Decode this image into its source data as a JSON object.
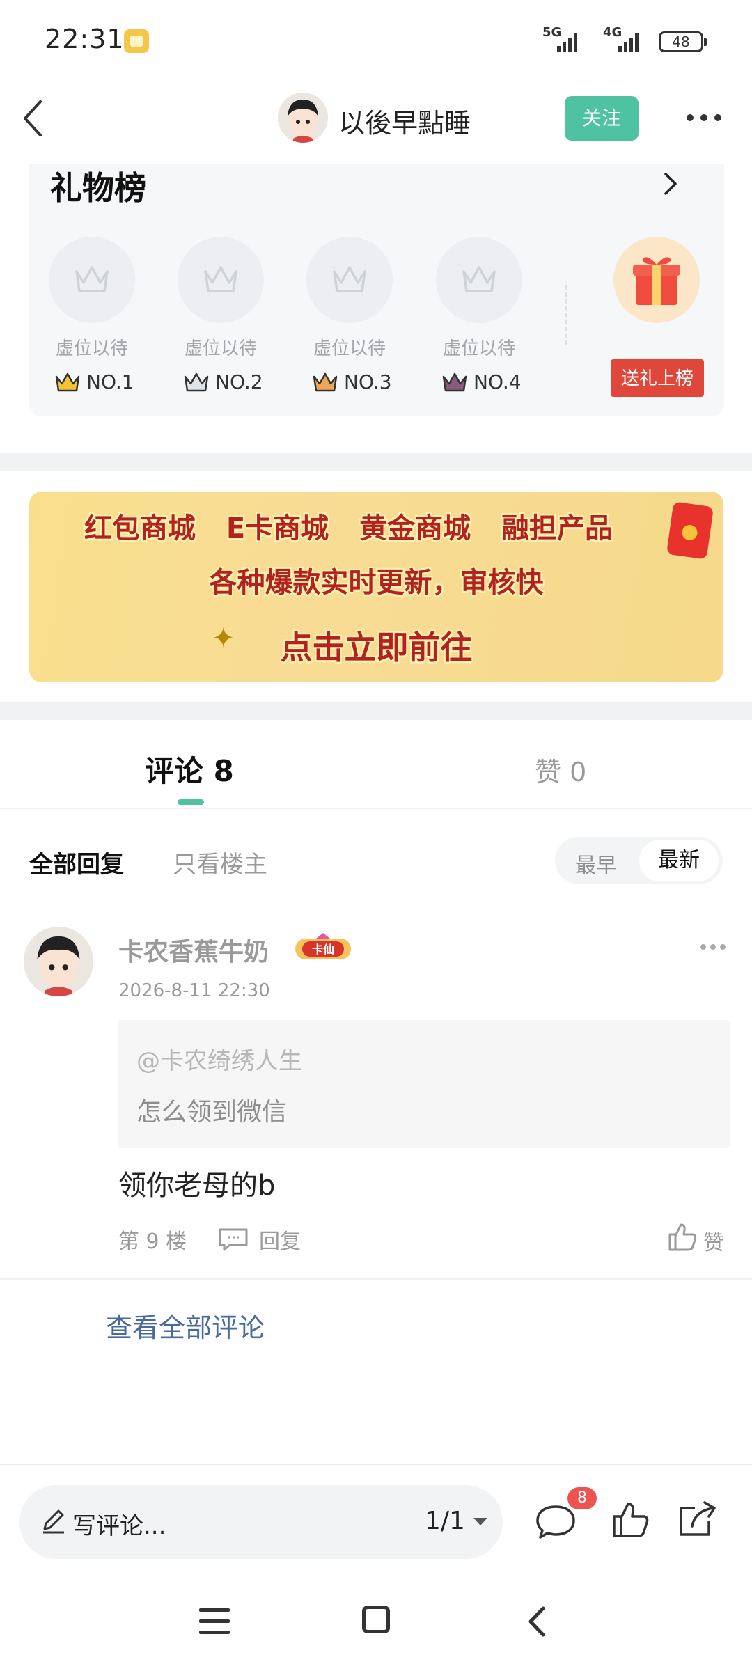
{
  "status_bar": {
    "time": "22:31",
    "net1": "5G",
    "net2": "4G",
    "battery": "48"
  },
  "header": {
    "name": "以後早點睡",
    "follow_label": "关注"
  },
  "gift_board": {
    "title": "礼物榜",
    "seats": [
      {
        "label": "虚位以待",
        "rank": "NO.1"
      },
      {
        "label": "虚位以待",
        "rank": "NO.2"
      },
      {
        "label": "虚位以待",
        "rank": "NO.3"
      },
      {
        "label": "虚位以待",
        "rank": "NO.4"
      }
    ],
    "send_label": "送礼上榜"
  },
  "banner": {
    "line1": "红包商城 E卡商城 黄金商城 融担产品",
    "line2": "各种爆款实时更新，审核快",
    "line3": "点击立即前往"
  },
  "tabs": {
    "comments": "评论 8",
    "likes": "赞 0"
  },
  "filters": {
    "all": "全部回复",
    "op_only": "只看楼主",
    "sort_oldest": "最早",
    "sort_newest": "最新"
  },
  "comment": {
    "author": "卡农香蕉牛奶",
    "badge": "卡仙",
    "time": "2026-8-11 22:30",
    "quote_at": "@卡农绮绣人生",
    "quote_text": "怎么领到微信",
    "body": "领你老母的b",
    "floor": "第 9 楼",
    "reply": "回复",
    "like": "赞"
  },
  "view_all": "查看全部评论",
  "bottom_bar": {
    "write_placeholder": "写评论...",
    "page": "1/1",
    "comment_count": "8"
  },
  "colors": {
    "accent": "#4fc3a1",
    "danger": "#e0473b",
    "link": "#4a6a9c"
  }
}
